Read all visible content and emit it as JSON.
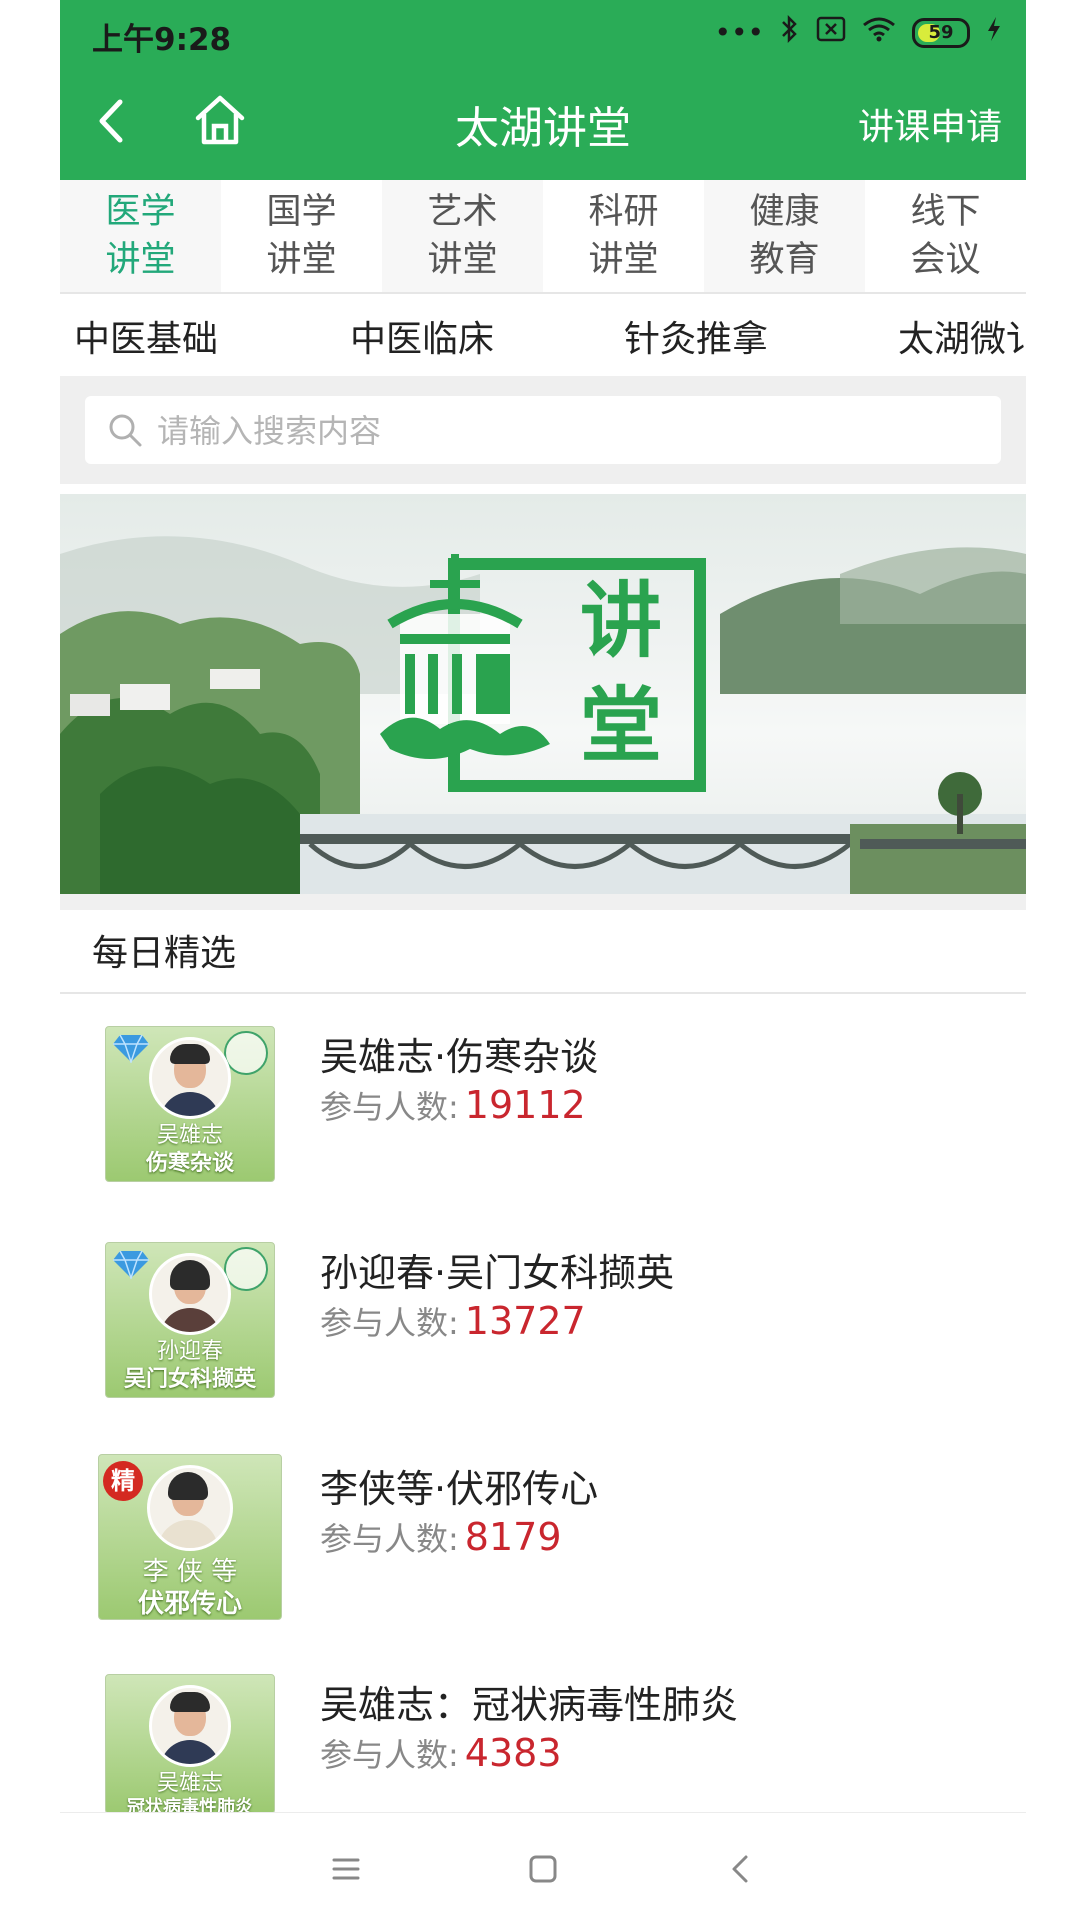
{
  "status_bar": {
    "time": "上午9:28",
    "battery": "59"
  },
  "header": {
    "title": "太湖讲堂",
    "action": "讲课申请"
  },
  "category_tabs": [
    {
      "line1": "医学",
      "line2": "讲堂",
      "active": true
    },
    {
      "line1": "国学",
      "line2": "讲堂",
      "active": false
    },
    {
      "line1": "艺术",
      "line2": "讲堂",
      "active": false
    },
    {
      "line1": "科研",
      "line2": "讲堂",
      "active": false
    },
    {
      "line1": "健康",
      "line2": "教育",
      "active": false
    },
    {
      "line1": "线下",
      "line2": "会议",
      "active": false
    }
  ],
  "sub_tabs": [
    "中医基础",
    "中医临床",
    "针灸推拿",
    "太湖微讠"
  ],
  "search": {
    "placeholder": "请输入搜索内容"
  },
  "banner": {
    "logo_text": "讲堂"
  },
  "section": {
    "title": "每日精选"
  },
  "courses": [
    {
      "title": "吴雄志·伤寒杂谈",
      "count_label": "参与人数:",
      "count": "19112",
      "thumb_name": "吴雄志",
      "thumb_course": "伤寒杂谈",
      "badge": "gem"
    },
    {
      "title": "孙迎春·吴门女科撷英",
      "count_label": "参与人数:",
      "count": "13727",
      "thumb_name": "孙迎春",
      "thumb_course": "吴门女科撷英",
      "badge": "gem"
    },
    {
      "title": "李侠等·伏邪传心",
      "count_label": "参与人数:",
      "count": "8179",
      "thumb_name": "李 侠 等",
      "thumb_course": "伏邪传心",
      "badge": "精"
    },
    {
      "title": "吴雄志：冠状病毒性肺炎",
      "count_label": "参与人数:",
      "count": "4383",
      "thumb_name": "吴雄志",
      "thumb_course": "冠状病毒性肺炎",
      "badge": "none"
    }
  ],
  "colors": {
    "header_green": "#2aac57",
    "active_tab": "#22a87a",
    "count_red": "#c9262e"
  }
}
